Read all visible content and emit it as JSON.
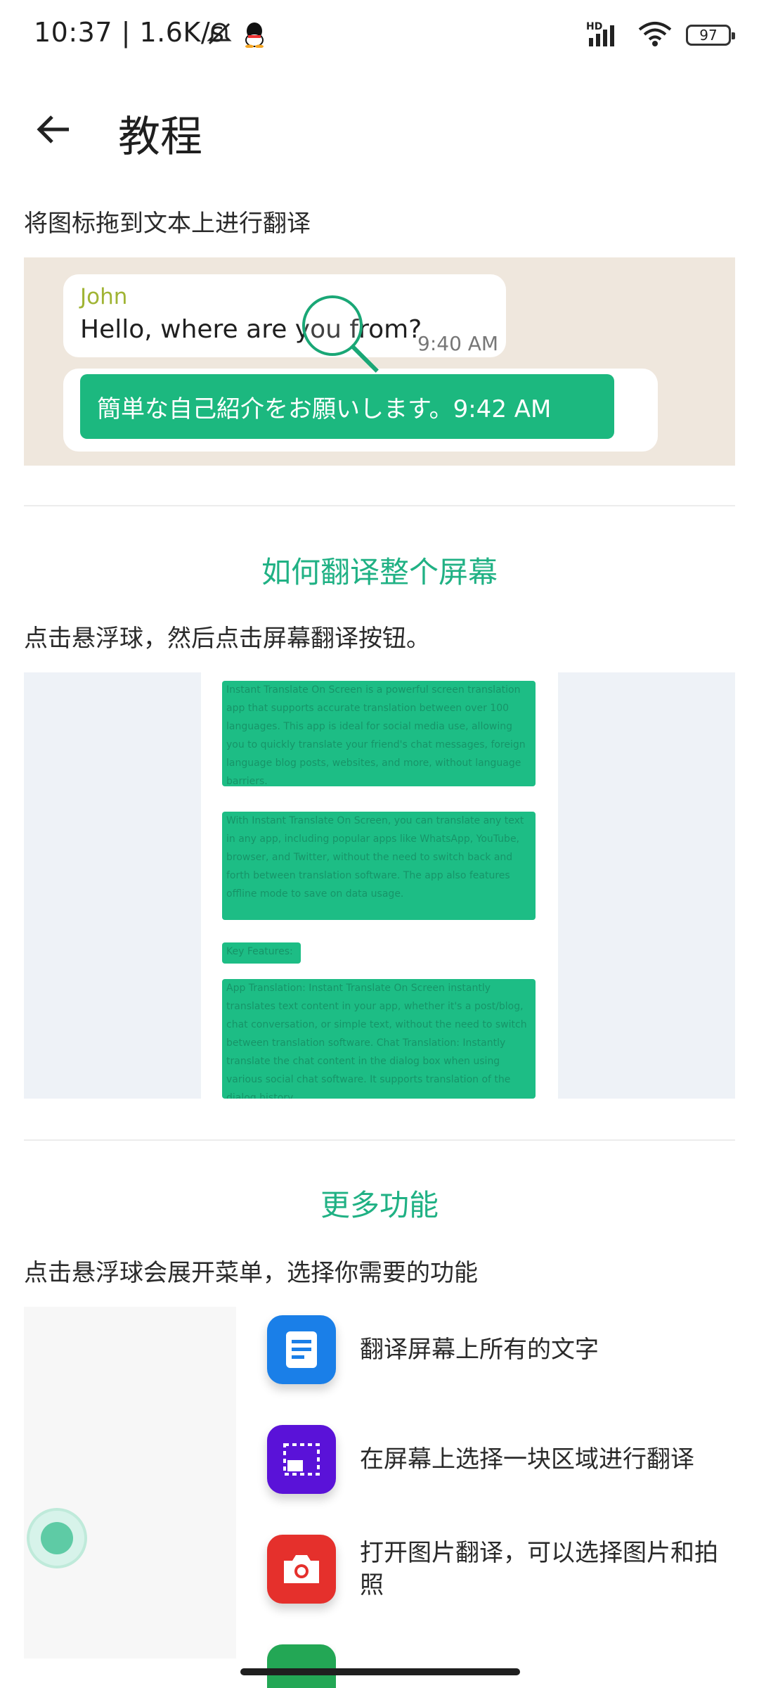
{
  "status_bar": {
    "time": "10:37 | 1.6K/s",
    "network": "HD",
    "battery": "97",
    "icons": [
      "mute-bell-icon",
      "qq-icon",
      "signal-icon",
      "wifi-icon",
      "battery-icon"
    ]
  },
  "header": {
    "title": "教程",
    "back_icon": "arrow-left-icon"
  },
  "drag_section": {
    "instruction": "将图标拖到文本上进行翻译",
    "demo": {
      "sender": "John",
      "message": "Hello, where are you from?",
      "time": "9:40 AM",
      "translation": "簡単な自己紹介をお願いします。9:42 AM"
    }
  },
  "screen_section": {
    "heading": "如何翻译整个屏幕",
    "instruction": "点击悬浮球，然后点击屏幕翻译按钮。",
    "demo_blocks": [
      "Instant Translate On Screen is a powerful screen translation app that supports accurate translation between over 100 languages. This app is ideal for social media use, allowing you to quickly translate your friend's chat messages, foreign language blog posts, websites, and more, without language barriers.",
      "With Instant Translate On Screen, you can translate any text in any app, including popular apps like WhatsApp, YouTube, browser, and Twitter, without the need to switch back and forth between translation software. The app also features offline mode to save on data usage.",
      "Key Features:",
      "App Translation: Instant Translate On Screen instantly translates text content in your app, whether it's a post/blog, chat conversation, or simple text, without the need to switch between translation software. Chat Translation: Instantly translate the chat content in the dialog box when using various social chat software. It supports translation of the dialog history."
    ]
  },
  "features_section": {
    "heading": "更多功能",
    "instruction": "点击悬浮球会展开菜单，选择你需要的功能",
    "items": [
      {
        "label": "翻译屏幕上所有的文字",
        "icon": "document-icon",
        "color": "#1a7fe8"
      },
      {
        "label": "在屏幕上选择一块区域进行翻译",
        "icon": "region-select-icon",
        "color": "#5a12d8"
      },
      {
        "label": "打开图片翻译，可以选择图片和拍照",
        "icon": "camera-icon",
        "color": "#e5302c"
      },
      {
        "label": "",
        "icon": "green-feature-icon",
        "color": "#23a755"
      }
    ]
  },
  "colors": {
    "accent": "#20b184",
    "translate_green": "#1cb87f"
  }
}
